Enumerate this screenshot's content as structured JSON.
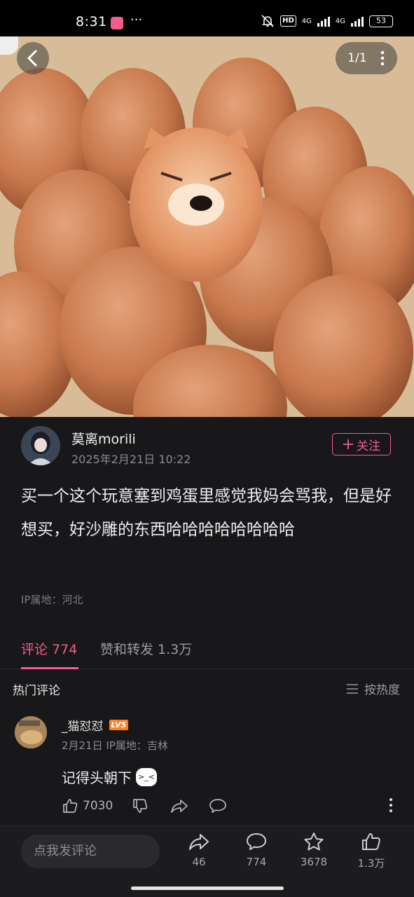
{
  "status_bar": {
    "time": "8:31",
    "more": "···",
    "battery": "53",
    "net1": "4G",
    "net2": "4G",
    "hd": "HD"
  },
  "photo_header": {
    "back_icon": "chevron-left-icon",
    "page_indicator": "1/1",
    "more_icon": "more-vertical-icon"
  },
  "author": {
    "name": "莫离morili",
    "date": "2025年2月21日 10:22",
    "follow_label": "关注",
    "follow_icon": "plus-icon"
  },
  "post": {
    "text": "买一个这个玩意塞到鸡蛋里感觉我妈会骂我，但是好想买，好沙雕的东西哈哈哈哈哈哈哈哈",
    "ip": "IP属地：河北"
  },
  "tabs": [
    {
      "label": "评论 774",
      "active": true
    },
    {
      "label": "赞和转发 1.3万",
      "active": false
    }
  ],
  "hot_comments": {
    "title": "热门评论",
    "sort_label": "按热度",
    "sort_icon": "list-icon"
  },
  "comments": [
    {
      "user": "_猫怼怼",
      "level": "LV5",
      "meta": "2月21日 IP属地：吉林",
      "text": "记得头朝下",
      "likes": "7030"
    }
  ],
  "bottom_bar": {
    "input_placeholder": "点我发评论",
    "share_count": "46",
    "comment_count": "774",
    "fav_count": "3678",
    "like_count": "1.3万"
  },
  "colors": {
    "accent": "#f25d8e",
    "background": "#18181b",
    "level_badge": "#ff7f24"
  }
}
